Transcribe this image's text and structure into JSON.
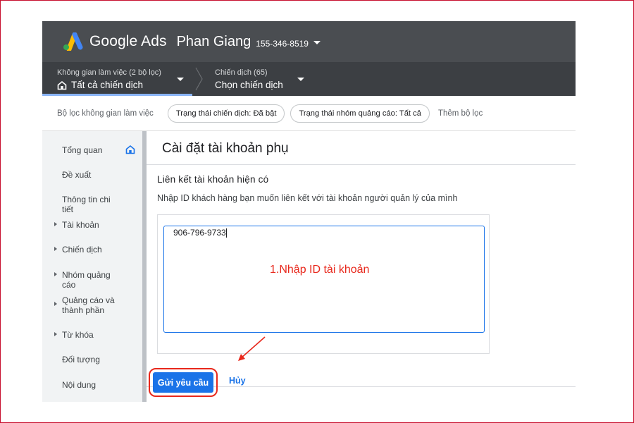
{
  "header": {
    "brand": "Google Ads",
    "account_name": "Phan Giang",
    "account_id": "155-346-8519"
  },
  "workspace": {
    "workspace_label": "Không gian làm việc (2 bộ lọc)",
    "workspace_value": "Tất cả chiến dịch",
    "campaign_label": "Chiến dịch (65)",
    "campaign_value": "Chọn chiến dịch"
  },
  "filters": {
    "label": "Bộ lọc không gian làm việc",
    "chips": [
      "Trạng thái chiến dịch: Đã bật",
      "Trạng thái nhóm quảng cáo: Tất cả"
    ],
    "add_filter": "Thêm bộ lọc"
  },
  "sidebar": {
    "items": [
      {
        "label": "Tổng quan"
      },
      {
        "label": "Đề xuất"
      },
      {
        "label": "Thông tin chi tiết"
      },
      {
        "label": "Tài khoản"
      },
      {
        "label": "Chiến dịch"
      },
      {
        "label": "Nhóm quảng cáo"
      },
      {
        "label": "Quảng cáo và thành phần"
      },
      {
        "label": "Từ khóa"
      },
      {
        "label": "Đối tượng"
      },
      {
        "label": "Nội dung"
      }
    ]
  },
  "main": {
    "title": "Cài đặt tài khoản phụ",
    "section_title": "Liên kết tài khoản hiện có",
    "section_desc": "Nhập ID khách hàng bạn muốn liên kết với tài khoản người quản lý của mình",
    "customer_id_value": "906-796-9733",
    "annotation": "1.Nhập ID tài khoản",
    "submit_label": "Gửi yêu cầu",
    "cancel_label": "Hủy"
  },
  "colors": {
    "header_bg": "#4a4d51",
    "workbar_bg": "#3c3f43",
    "primary": "#1a73e8",
    "annotation_red": "#e8281c"
  }
}
